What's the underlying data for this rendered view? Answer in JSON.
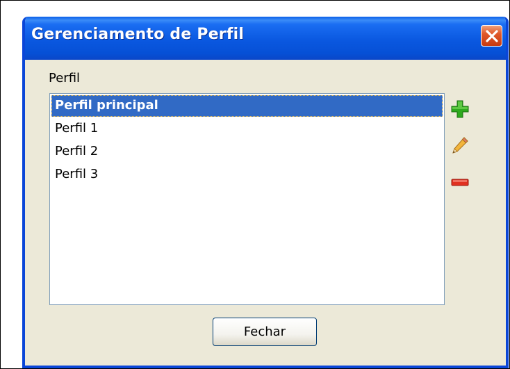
{
  "window": {
    "title": "Gerenciamento de Perfil"
  },
  "profile_section": {
    "label": "Perfil",
    "items": [
      {
        "label": "Perfil principal",
        "selected": true
      },
      {
        "label": "Perfil 1",
        "selected": false
      },
      {
        "label": "Perfil 2",
        "selected": false
      },
      {
        "label": "Perfil 3",
        "selected": false
      }
    ]
  },
  "actions": {
    "add_icon": "plus-icon",
    "edit_icon": "pencil-icon",
    "remove_icon": "minus-icon"
  },
  "footer": {
    "close_label": "Fechar"
  },
  "colors": {
    "title_bar": "#0a58e0",
    "selection": "#316ac5",
    "window_body": "#ece9d8",
    "add": "#2eaa1e",
    "remove": "#e03020"
  }
}
